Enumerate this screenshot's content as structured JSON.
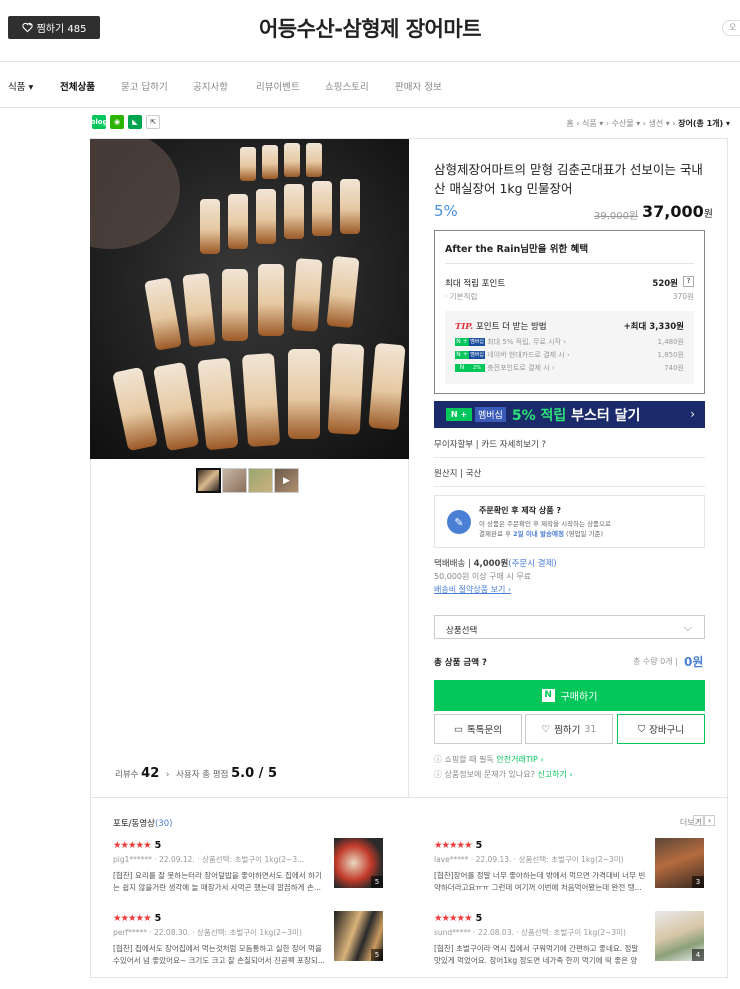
{
  "header": {
    "zzim_label": "찜하기 485",
    "store_name": "어등수산-삼형제 장어마트",
    "right_pill": "오"
  },
  "nav": {
    "items": [
      "식품 ▾",
      "전체상품",
      "묻고 답하기",
      "공지사항",
      "리뷰이벤트",
      "쇼핑스토리",
      "판매자 정보"
    ],
    "active_index": 1
  },
  "share": [
    "blog",
    "talk",
    "story",
    "share"
  ],
  "breadcrumb": {
    "path": "홈 › 식품 ▾ › 수산물 ▾ › 생선 ▾ › ",
    "current": "장어(총 1개) ▾"
  },
  "product": {
    "title": "삼형제장어마트의 맏형 김춘곤대표가 선보이는 국내산 매실장어 1kg 민물장어",
    "discount": "5%",
    "original_price": "39,000원",
    "final_price": "37,000",
    "final_unit": "원"
  },
  "benefit": {
    "title": "After the Rain님만을 위한 혜택",
    "max_point_label": "최대 적립 포인트",
    "max_point_value": "520원",
    "help": "?",
    "basic_label": "· 기본적립",
    "basic_value": "370원",
    "tip_label": "TIP.",
    "tip_title": "포인트 더 받는 방법",
    "tip_max": "+최대 3,330원",
    "tips": [
      {
        "badge": "N + 멤버십",
        "text": "최대 5% 적립, 무료 시작 ›",
        "value": "1,480원"
      },
      {
        "badge": "N + 멤버십",
        "text": "네이버 현대카드로 결제 시 ›",
        "value": "1,850원"
      },
      {
        "badge": "N 2%",
        "text": "충전포인트로 결제 시 ›",
        "value": "740원"
      }
    ]
  },
  "booster": {
    "n": "N +",
    "member": "멤버십",
    "highlight": "5% 적립",
    "rest": " 부스터 달기",
    "arrow": "›"
  },
  "info": {
    "installment": "무이자할부 | 카드 자세히보기 ?",
    "origin": "원산지 | 국산",
    "order_title": "주문확인 후 제작 상품 ?",
    "order_line1": "이 상품은 주문확인 후 제작을 시작하는 상품으로",
    "order_line2_a": "결제완료 후 ",
    "order_line2_b": "2일 이내 발송예정",
    "order_line2_c": " (영업일 기준)",
    "ship_label": "택배배송 | ",
    "ship_price": "4,000원",
    "ship_cond": "(주문시 결제)",
    "ship_free": "50,000원 이상 구매 시 무료",
    "ship_link": "배송비 절약상품 보기 ›"
  },
  "purchase": {
    "select_placeholder": "상품선택",
    "total_label": "총 상품 금액 ?",
    "total_qty": "총 수량 0개 |",
    "total_value": "0원",
    "buy_label": "구매하기",
    "talk_label": "톡톡문의",
    "zzim_label": "찜하기",
    "zzim_count": "31",
    "cart_label": "장바구니",
    "notice1_a": "ⓘ 쇼핑할 때 필독 ",
    "notice1_b": "안전거래TIP ›",
    "notice2_a": "ⓘ 상품정보에 문제가 있나요? ",
    "notice2_b": "신고하기 ›"
  },
  "left_stats": {
    "review_label": "리뷰수",
    "review_count": "42",
    "rating_label": "사용자 총 평점",
    "rating_value": "5.0",
    "rating_max": "5"
  },
  "reviews_section": {
    "title": "포토/동영상",
    "count": "(30)",
    "more": "더보기",
    "prev": "‹",
    "next": "›"
  },
  "reviews": [
    {
      "stars": "★★★★★",
      "score": "5",
      "meta": "pig1****** · 22.09.12. · 상품선택: 초벌구이 1kg(2~3...",
      "text": "[협찬] 요리를 잘 못하는터라 장어덮밥을 좋아하면서도 집에서 하기는 쉽지 않을거란 생각에 늘 매장가서 사먹곤 했는데 깔끔하게 손...",
      "img_count": "5"
    },
    {
      "stars": "★★★★★",
      "score": "5",
      "meta": "lave***** · 22.09.13. · 상품선택: 초벌구이 1kg(2~3미)",
      "text": "[협찬]장어를 정말 너무 좋아하는데 밖에서 먹으면 가격대비 너무 빈약하더라고요ㅠㅠ 그런데 여기꺼 이번에 처음먹어봤는데 완전 탱...",
      "img_count": "3"
    },
    {
      "stars": "★★★★★",
      "score": "5",
      "meta": "perf***** · 22.08.30. · 상품선택: 초벌구이 1kg(2~3미)",
      "text": "[협찬] 집에서도 장어집에서 먹는것처럼 모듬통하고 실한 장어 먹을수있어서 넘 좋았어요~ 크기도 크고 잘 손질되어서 진공팩 포장되...",
      "img_count": "5"
    },
    {
      "stars": "★★★★★",
      "score": "5",
      "meta": "sund***** · 22.08.03. · 상품선택: 초벌구이 1kg(2~3미)",
      "text": "[협찬] 초벌구이라 역시 집에서 구워먹기에 간편하고 좋네요. 정말 맛있게 먹었어요. 장어1kg 정도면 네가족 한끼 먹기에 딱 좋은 양인...",
      "img_count": "4"
    }
  ]
}
